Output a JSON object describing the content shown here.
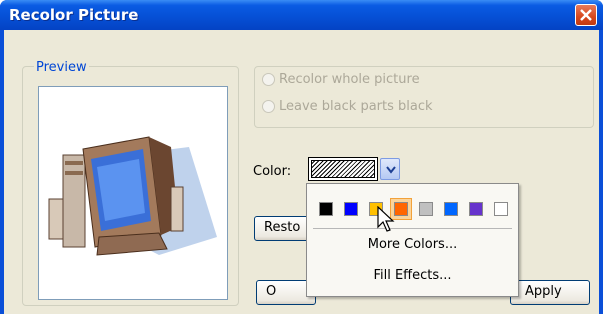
{
  "window": {
    "title": "Recolor Picture"
  },
  "preview": {
    "legend": "Preview"
  },
  "options": {
    "recolor_whole": "Recolor whole picture",
    "leave_black": "Leave black parts black"
  },
  "color": {
    "label": "Color:"
  },
  "buttons": {
    "restore": "Resto",
    "ok": "O",
    "apply": "Apply"
  },
  "popup": {
    "swatches": [
      {
        "name": "black",
        "hex": "#000000"
      },
      {
        "name": "blue",
        "hex": "#0000ff"
      },
      {
        "name": "gold",
        "hex": "#ffc000"
      },
      {
        "name": "orange",
        "hex": "#ff6600",
        "selected": true
      },
      {
        "name": "gray",
        "hex": "#c0c0c0"
      },
      {
        "name": "dodger-blue",
        "hex": "#0066ff"
      },
      {
        "name": "purple",
        "hex": "#6633cc"
      },
      {
        "name": "white",
        "hex": "#ffffff"
      }
    ],
    "more_colors": "More Colors...",
    "fill_effects": "Fill Effects..."
  },
  "colors": {
    "title_bar": "#0a5be3",
    "dialog_bg": "#ece9d8",
    "legend_text": "#0046d5",
    "disabled_text": "#aca899"
  }
}
